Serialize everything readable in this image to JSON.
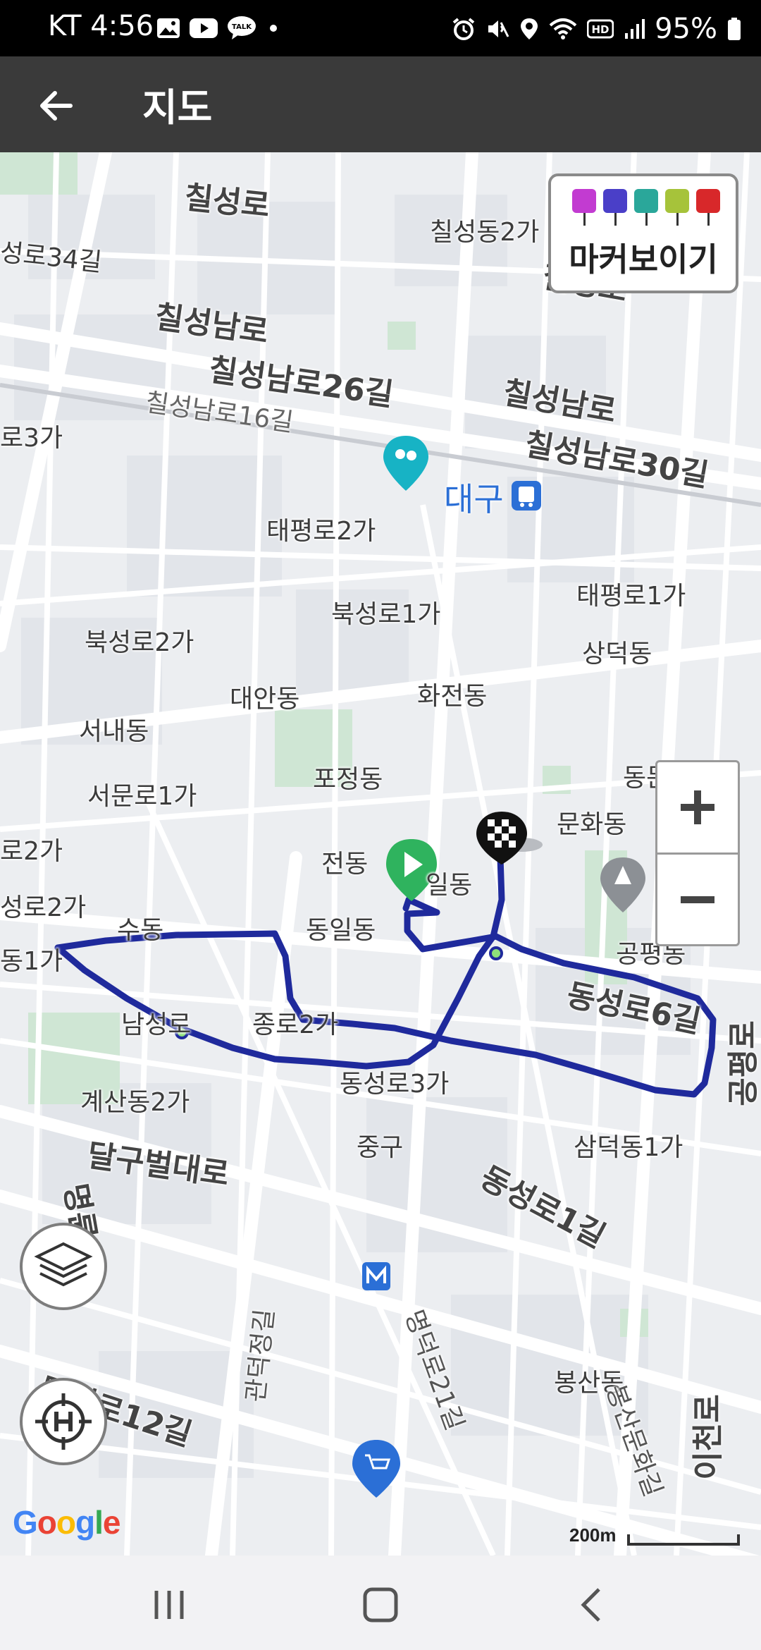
{
  "status_bar": {
    "carrier_time": "KT 4:56",
    "battery": "95%",
    "left_icons": [
      "gallery-icon",
      "youtube-icon",
      "talk-icon",
      "dot-icon"
    ],
    "right_icons": [
      "alarm-icon",
      "mute-icon",
      "location-icon",
      "wifi-icon",
      "hd-icon",
      "signal-icon",
      "battery-icon"
    ],
    "talk_badge": "TALK",
    "hd_badge": "HD"
  },
  "app_bar": {
    "title": "지도",
    "back_icon": "back-arrow-icon"
  },
  "map": {
    "marker_toggle": {
      "label": "마커보이기",
      "flag_colors": [
        "#c23bd1",
        "#4a3fc8",
        "#2aa79a",
        "#a6c33a",
        "#d8282a"
      ]
    },
    "route_color": "#1f2a9c",
    "start_marker_color": "#2fb35e",
    "labels": [
      {
        "id": "chilseong-ro",
        "text": "칠성로",
        "style": "big"
      },
      {
        "id": "chilseong-dong-2ga",
        "text": "칠성동2가",
        "style": "normal"
      },
      {
        "id": "seongro-34gil",
        "text": "성로34길",
        "style": "normal"
      },
      {
        "id": "chilseong-ro-2",
        "text": "칠성로",
        "style": "big"
      },
      {
        "id": "chilseongnam-ro",
        "text": "칠성남로",
        "style": "big"
      },
      {
        "id": "chilseongnam-ro-26gil",
        "text": "칠성남로26길",
        "style": "big"
      },
      {
        "id": "chilseongnam-ro-16gil",
        "text": "칠성남로16길",
        "style": "normal"
      },
      {
        "id": "ro-3ga",
        "text": "로3가",
        "style": "normal"
      },
      {
        "id": "chilseongnam-ro-2",
        "text": "칠성남로",
        "style": "big"
      },
      {
        "id": "chilseongnam-ro-30gil",
        "text": "칠성남로30길",
        "style": "big"
      },
      {
        "id": "daegu-station",
        "text": "대구",
        "style": "blue"
      },
      {
        "id": "taepyeong-ro-2ga",
        "text": "태평로2가",
        "style": "normal"
      },
      {
        "id": "taepyeong-ro-1ga",
        "text": "태평로1가",
        "style": "normal"
      },
      {
        "id": "bukseong-ro-1ga",
        "text": "북성로1가",
        "style": "normal"
      },
      {
        "id": "bukseong-ro-2ga",
        "text": "북성로2가",
        "style": "normal"
      },
      {
        "id": "sangdeok-dong",
        "text": "상덕동",
        "style": "normal"
      },
      {
        "id": "daean-dong",
        "text": "대안동",
        "style": "normal"
      },
      {
        "id": "hwajeon-dong",
        "text": "화전동",
        "style": "normal"
      },
      {
        "id": "seonae-dong",
        "text": "서내동",
        "style": "normal"
      },
      {
        "id": "pojeong-dong",
        "text": "포정동",
        "style": "normal"
      },
      {
        "id": "seomun-ro-1ga",
        "text": "서문로1가",
        "style": "normal"
      },
      {
        "id": "dongmun-dong",
        "text": "동문동",
        "style": "normal"
      },
      {
        "id": "munhwa-dong",
        "text": "문화동",
        "style": "normal"
      },
      {
        "id": "ro-2ga",
        "text": "로2가",
        "style": "normal"
      },
      {
        "id": "jeon-dong",
        "text": "전동",
        "style": "normal"
      },
      {
        "id": "il-dong",
        "text": "일동",
        "style": "normal"
      },
      {
        "id": "seongro-2ga",
        "text": "성로2가",
        "style": "normal"
      },
      {
        "id": "su-dong",
        "text": "수동",
        "style": "normal"
      },
      {
        "id": "dongil-dong",
        "text": "동일동",
        "style": "normal"
      },
      {
        "id": "gongpyeong-dong",
        "text": "공평동",
        "style": "normal"
      },
      {
        "id": "dong-1ga",
        "text": "동1가",
        "style": "normal"
      },
      {
        "id": "namseong-ro",
        "text": "남성로",
        "style": "normal"
      },
      {
        "id": "jongro-2ga",
        "text": "종로2가",
        "style": "normal"
      },
      {
        "id": "dongseong-ro-6gil",
        "text": "동성로6길",
        "style": "big"
      },
      {
        "id": "gyesan-dong-2ga",
        "text": "계산동2가",
        "style": "normal"
      },
      {
        "id": "dongseong-ro-3ga",
        "text": "동성로3가",
        "style": "normal"
      },
      {
        "id": "samdeok-dong-1ga",
        "text": "삼덕동1가",
        "style": "normal"
      },
      {
        "id": "jung-gu",
        "text": "중구",
        "style": "normal"
      },
      {
        "id": "dalgubeol-daero",
        "text": "달구벌대로",
        "style": "big"
      },
      {
        "id": "dongseong-ro-1gil",
        "text": "동성로1길",
        "style": "big"
      },
      {
        "id": "bongsan-dong",
        "text": "봉산동",
        "style": "normal"
      },
      {
        "id": "myeongdeok-ro-12gil",
        "text": "명덕로12길",
        "style": "big"
      },
      {
        "id": "gwandeokjeong-gil",
        "text": "관덕정길",
        "style": "normal"
      },
      {
        "id": "myeongdeok-ro-21gil",
        "text": "명덕로21길",
        "style": "normal"
      },
      {
        "id": "bongsan-munhwa-gil",
        "text": "봉산문화길",
        "style": "normal"
      },
      {
        "id": "icheon-ro",
        "text": "이천로",
        "style": "big"
      },
      {
        "id": "gongpyeong-ro",
        "text": "공평로",
        "style": "big"
      },
      {
        "id": "gamrogil",
        "text": "명륜로",
        "style": "big"
      }
    ],
    "zoom": {
      "plus_icon": "plus-icon",
      "minus_icon": "minus-icon"
    },
    "layers_icon": "layers-icon",
    "home_location_icon": "home-target-icon",
    "attribution": {
      "text": "Google",
      "letter_colors": [
        "#4285f4",
        "#ea4335",
        "#fbbc05",
        "#4285f4",
        "#34a853",
        "#ea4335"
      ]
    },
    "scale_label": "200m"
  },
  "nav_bar": {
    "recent_icon": "recent-apps-icon",
    "home_icon": "home-icon",
    "back_icon": "back-icon"
  }
}
